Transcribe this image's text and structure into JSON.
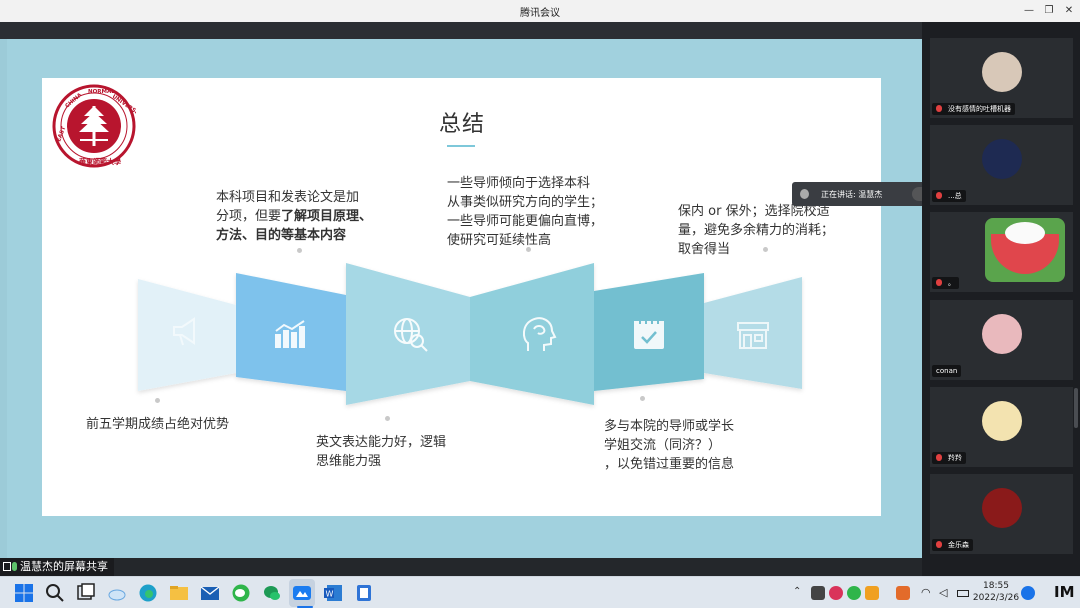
{
  "window": {
    "title": "腾讯会议"
  },
  "slide": {
    "title": "总结",
    "logo_text": "EAST CHINA NORMAL UNIVERSITY · 華東師範大學",
    "notes": [
      {
        "id": "n1",
        "lines": [
          "前五学期成绩占绝对优势"
        ]
      },
      {
        "id": "n2",
        "lines": [
          "本科项目和发表论文是加",
          "分项，但要了解项目原理、",
          "方法、目的等基本内容"
        ]
      },
      {
        "id": "n3",
        "lines": [
          "英文表达能力好，逻辑",
          "思维能力强"
        ]
      },
      {
        "id": "n4",
        "lines": [
          "一些导师倾向于选择本科",
          "从事类似研究方向的学生；",
          "一些导师可能更偏向直博，",
          "使研究可延续性高"
        ]
      },
      {
        "id": "n5",
        "lines": [
          "多与本院的导师或学长",
          "学姐交流（同济？）",
          "，以免错过重要的信息"
        ]
      },
      {
        "id": "n6",
        "lines": [
          "保内 or 保外；选择院校适",
          "量，避免多余精力的消耗；",
          "取舍得当"
        ]
      }
    ],
    "panel_icons": [
      "megaphone-icon",
      "bar-chart-icon",
      "globe-search-icon",
      "head-brain-icon",
      "calendar-check-icon",
      "storefront-icon"
    ],
    "colors": {
      "panel1": "#e3f1f7",
      "panel2": "#7fc3ec",
      "panel3": "#a5d7e4",
      "panel4": "#8fcdd9",
      "panel5": "#71bccd",
      "panel6": "#b3dbe6"
    }
  },
  "speaking": {
    "text": "正在讲话: 温慧杰"
  },
  "participants": [
    {
      "name": "没有感情的吐槽机器"
    },
    {
      "name": "...总"
    },
    {
      "name": "。"
    },
    {
      "name": "conan"
    },
    {
      "name": "羚羚"
    },
    {
      "name": "金乐森"
    }
  ],
  "share_label": "温慧杰的屏幕共享",
  "clock": {
    "time": "18:55",
    "date": "2022/3/26"
  },
  "taskbar_apps": [
    "windows-start-icon",
    "search-icon",
    "task-view-icon",
    "cloud-icon",
    "edge-icon",
    "file-explorer-icon",
    "mail-icon",
    "wechat-icon",
    "wechat-work-icon",
    "tencent-meeting-icon",
    "word-icon",
    "notes-icon"
  ]
}
